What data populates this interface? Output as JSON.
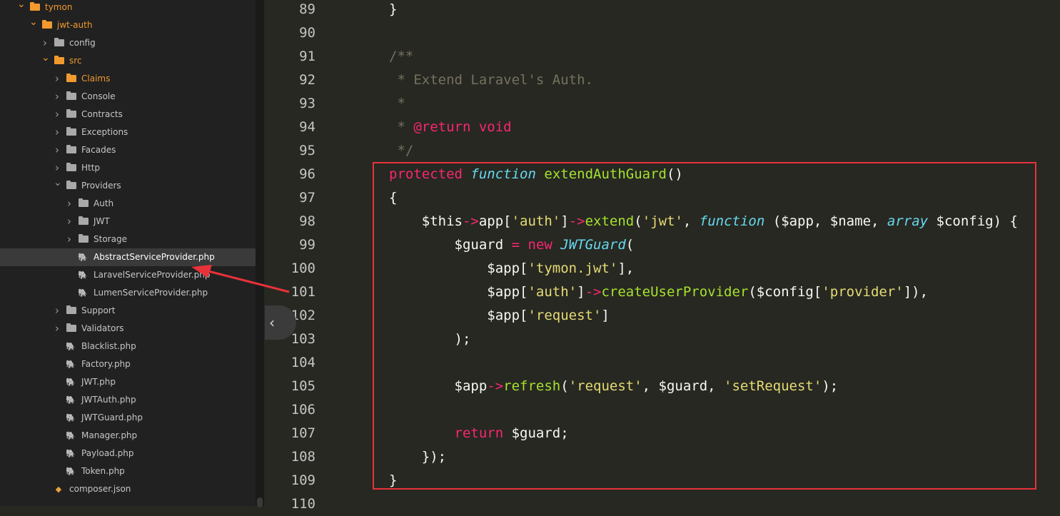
{
  "sidebar": {
    "rows": [
      {
        "label": "tymon",
        "kind": "folder",
        "state": "open",
        "depth": 0,
        "accent": true
      },
      {
        "label": "jwt-auth",
        "kind": "folder",
        "state": "open",
        "depth": 1,
        "accent": true
      },
      {
        "label": "config",
        "kind": "folder",
        "state": "closed",
        "depth": 2
      },
      {
        "label": "src",
        "kind": "folder",
        "state": "open",
        "depth": 2,
        "accent": true
      },
      {
        "label": "Claims",
        "kind": "folder",
        "state": "closed",
        "depth": 3,
        "accent": true
      },
      {
        "label": "Console",
        "kind": "folder",
        "state": "closed",
        "depth": 3
      },
      {
        "label": "Contracts",
        "kind": "folder",
        "state": "closed",
        "depth": 3
      },
      {
        "label": "Exceptions",
        "kind": "folder",
        "state": "closed",
        "depth": 3
      },
      {
        "label": "Facades",
        "kind": "folder",
        "state": "closed",
        "depth": 3
      },
      {
        "label": "Http",
        "kind": "folder",
        "state": "closed",
        "depth": 3
      },
      {
        "label": "Providers",
        "kind": "folder",
        "state": "open",
        "depth": 3
      },
      {
        "label": "Auth",
        "kind": "folder",
        "state": "closed",
        "depth": 4
      },
      {
        "label": "JWT",
        "kind": "folder",
        "state": "closed",
        "depth": 4
      },
      {
        "label": "Storage",
        "kind": "folder",
        "state": "closed",
        "depth": 4
      },
      {
        "label": "AbstractServiceProvider.php",
        "kind": "php",
        "depth": 4,
        "selected": true
      },
      {
        "label": "LaravelServiceProvider.php",
        "kind": "php",
        "depth": 4
      },
      {
        "label": "LumenServiceProvider.php",
        "kind": "php",
        "depth": 4
      },
      {
        "label": "Support",
        "kind": "folder",
        "state": "closed",
        "depth": 3
      },
      {
        "label": "Validators",
        "kind": "folder",
        "state": "closed",
        "depth": 3
      },
      {
        "label": "Blacklist.php",
        "kind": "php",
        "depth": 3
      },
      {
        "label": "Factory.php",
        "kind": "php",
        "depth": 3
      },
      {
        "label": "JWT.php",
        "kind": "php",
        "depth": 3
      },
      {
        "label": "JWTAuth.php",
        "kind": "php",
        "depth": 3
      },
      {
        "label": "JWTGuard.php",
        "kind": "php",
        "depth": 3
      },
      {
        "label": "Manager.php",
        "kind": "php",
        "depth": 3
      },
      {
        "label": "Payload.php",
        "kind": "php",
        "depth": 3
      },
      {
        "label": "Token.php",
        "kind": "php",
        "depth": 3
      },
      {
        "label": "composer.json",
        "kind": "json",
        "depth": 2
      }
    ]
  },
  "editor": {
    "lines": [
      {
        "n": "89",
        "tokens": [
          [
            "w",
            "}"
          ]
        ]
      },
      {
        "n": "90",
        "tokens": []
      },
      {
        "n": "91",
        "tokens": [
          [
            "c",
            "/**"
          ]
        ]
      },
      {
        "n": "92",
        "tokens": [
          [
            "c",
            " * Extend Laravel's Auth."
          ]
        ]
      },
      {
        "n": "93",
        "tokens": [
          [
            "c",
            " *"
          ]
        ]
      },
      {
        "n": "94",
        "tokens": [
          [
            "c",
            " * "
          ],
          [
            "k",
            "@return"
          ],
          [
            "c",
            " "
          ],
          [
            "k",
            "void"
          ]
        ]
      },
      {
        "n": "95",
        "tokens": [
          [
            "c",
            " */"
          ]
        ]
      },
      {
        "n": "96",
        "tokens": [
          [
            "k",
            "protected"
          ],
          [
            "w",
            " "
          ],
          [
            "t",
            "function"
          ],
          [
            "w",
            " "
          ],
          [
            "f",
            "extendAuthGuard"
          ],
          [
            "w",
            "()"
          ]
        ]
      },
      {
        "n": "97",
        "tokens": [
          [
            "w",
            "{"
          ]
        ]
      },
      {
        "n": "98",
        "tokens": [
          [
            "w",
            "    $this"
          ],
          [
            "k",
            "->"
          ],
          [
            "w",
            "app["
          ],
          [
            "s",
            "'auth'"
          ],
          [
            "w",
            "]"
          ],
          [
            "k",
            "->"
          ],
          [
            "f",
            "extend"
          ],
          [
            "w",
            "("
          ],
          [
            "s",
            "'jwt'"
          ],
          [
            "w",
            ", "
          ],
          [
            "t",
            "function"
          ],
          [
            "w",
            " ($app, $name, "
          ],
          [
            "t",
            "array"
          ],
          [
            "w",
            " $config) {"
          ]
        ]
      },
      {
        "n": "99",
        "tokens": [
          [
            "w",
            "        $guard "
          ],
          [
            "k",
            "="
          ],
          [
            "w",
            " "
          ],
          [
            "k",
            "new"
          ],
          [
            "w",
            " "
          ],
          [
            "t",
            "JWTGuard"
          ],
          [
            "w",
            "("
          ]
        ]
      },
      {
        "n": "100",
        "tokens": [
          [
            "w",
            "            $app["
          ],
          [
            "s",
            "'tymon.jwt'"
          ],
          [
            "w",
            "],"
          ]
        ]
      },
      {
        "n": "101",
        "tokens": [
          [
            "w",
            "            $app["
          ],
          [
            "s",
            "'auth'"
          ],
          [
            "w",
            "]"
          ],
          [
            "k",
            "->"
          ],
          [
            "f",
            "createUserProvider"
          ],
          [
            "w",
            "($config["
          ],
          [
            "s",
            "'provider'"
          ],
          [
            "w",
            "]),"
          ]
        ]
      },
      {
        "n": "102",
        "tokens": [
          [
            "w",
            "            $app["
          ],
          [
            "s",
            "'request'"
          ],
          [
            "w",
            "]"
          ]
        ]
      },
      {
        "n": "103",
        "tokens": [
          [
            "w",
            "        );"
          ]
        ]
      },
      {
        "n": "104",
        "tokens": []
      },
      {
        "n": "105",
        "tokens": [
          [
            "w",
            "        $app"
          ],
          [
            "k",
            "->"
          ],
          [
            "f",
            "refresh"
          ],
          [
            "w",
            "("
          ],
          [
            "s",
            "'request'"
          ],
          [
            "w",
            ", $guard, "
          ],
          [
            "s",
            "'setRequest'"
          ],
          [
            "w",
            ");"
          ]
        ]
      },
      {
        "n": "106",
        "tokens": []
      },
      {
        "n": "107",
        "tokens": [
          [
            "w",
            "        "
          ],
          [
            "k",
            "return"
          ],
          [
            "w",
            " $guard;"
          ]
        ]
      },
      {
        "n": "108",
        "tokens": [
          [
            "w",
            "    });"
          ]
        ]
      },
      {
        "n": "109",
        "tokens": [
          [
            "w",
            "}"
          ]
        ]
      },
      {
        "n": "110",
        "tokens": []
      }
    ]
  },
  "icons": {
    "collapse": "chevron-left-icon",
    "folder": "folder-icon",
    "php": "php-elephant-icon",
    "json": "json-file-icon"
  },
  "colors": {
    "highlight_box": "#e8323a",
    "folder_accent": "#f29a2e",
    "keyword": "#f92672",
    "string": "#e6db74",
    "function": "#a6e22e",
    "type": "#66d9ef",
    "comment": "#75715e"
  }
}
